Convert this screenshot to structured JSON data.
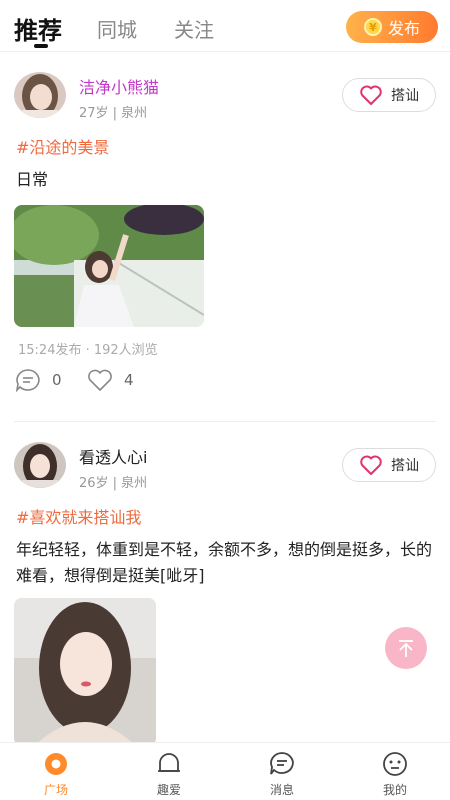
{
  "header": {
    "tabs": [
      "推荐",
      "同城",
      "关注"
    ],
    "publish_label": "发布",
    "publish_icon": "¥"
  },
  "posts": [
    {
      "username": "洁净小熊猫",
      "username_color": "#c23ac8",
      "meta": "27岁 | 泉州",
      "chat_label": "搭讪",
      "topic": "#沿途的美景",
      "content": "日常",
      "time": "15:24发布 · 192人浏览",
      "comments": "0",
      "likes": "4"
    },
    {
      "username": "看透人心i",
      "username_color": "#222222",
      "meta": "26岁 | 泉州",
      "chat_label": "搭讪",
      "topic": "#喜欢就来搭讪我",
      "content": "年纪轻轻，体重到是不轻，余额不多，想的倒是挺多，长的难看，想得倒是挺美[呲牙]"
    }
  ],
  "nav": {
    "items": [
      "广场",
      "趣爱",
      "消息",
      "我的"
    ]
  },
  "colors": {
    "accent": "#ff8a2a",
    "topic": "#f06a3e",
    "heart": "#e0336f"
  }
}
